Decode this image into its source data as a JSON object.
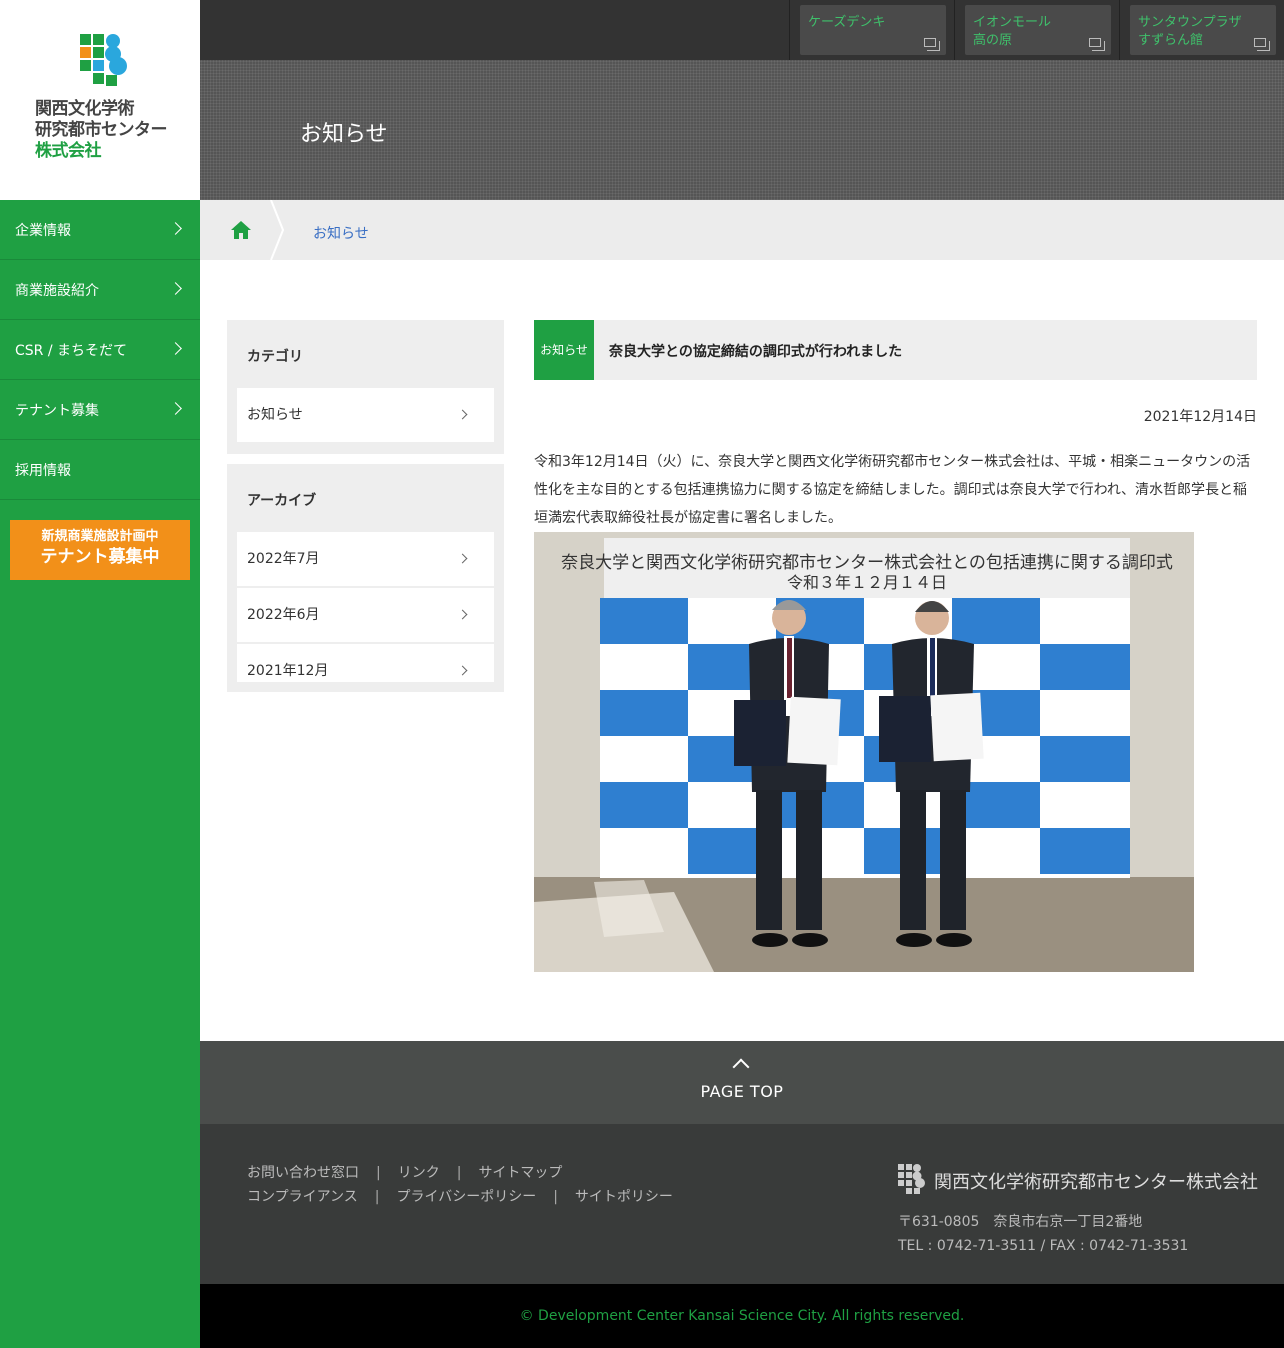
{
  "logo": {
    "line1": "関西文化学術",
    "line2": "研究都市センター",
    "line3": "株式会社"
  },
  "sidebar": {
    "items": [
      {
        "label": "企業情報"
      },
      {
        "label": "商業施設紹介"
      },
      {
        "label": "CSR / まちそだて"
      },
      {
        "label": "テナント募集"
      },
      {
        "label": "採用情報"
      }
    ],
    "banner": {
      "line1": "新規商業施設計画中",
      "line2": "テナント募集中"
    }
  },
  "stores": [
    {
      "line1": "ケーズデンキ",
      "line2": ""
    },
    {
      "line1": "イオンモール",
      "line2": "高の原"
    },
    {
      "line1": "サンタウンプラザ",
      "line2": "すずらん館"
    }
  ],
  "hero": {
    "title": "お知らせ"
  },
  "breadcrumb": {
    "current": "お知らせ"
  },
  "category": {
    "heading": "カテゴリ",
    "items": [
      "お知らせ"
    ]
  },
  "archive": {
    "heading": "アーカイブ",
    "items": [
      "2022年7月",
      "2022年6月",
      "2021年12月"
    ]
  },
  "article": {
    "category": "お知らせ",
    "title": "奈良大学との協定締結の調印式が行われました",
    "date": "2021年12月14日",
    "body": "令和3年12月14日（火）に、奈良大学と関西文化学術研究都市センター株式会社は、平城・相楽ニュータウンの活性化を主な目的とする包括連携協力に関する協定を締結しました。調印式は奈良大学で行われ、清水哲郎学長と稲垣満宏代表取締役社長が協定書に署名しました。",
    "photo": {
      "banner_line1": "奈良大学と関西文化学術研究都市センター株式会社との包括連携に関する調印式",
      "banner_line2": "令和３年１２月１４日"
    }
  },
  "footer": {
    "pagetop": "PAGE TOP",
    "links_row1": [
      "お問い合わせ窓口",
      "リンク",
      "サイトマップ"
    ],
    "links_row2": [
      "コンプライアンス",
      "プライバシーポリシー",
      "サイトポリシー"
    ],
    "company": "関西文化学術研究都市センター株式会社",
    "address": "〒631-0805　奈良市右京一丁目2番地",
    "tel": "TEL : 0742-71-3511 / FAX : 0742-71-3531",
    "copyright": "© Development Center Kansai Science City. All rights reserved."
  },
  "colors": {
    "brand_green": "#1fa043",
    "banner_orange": "#f29019",
    "link_blue": "#3a6fc4"
  }
}
